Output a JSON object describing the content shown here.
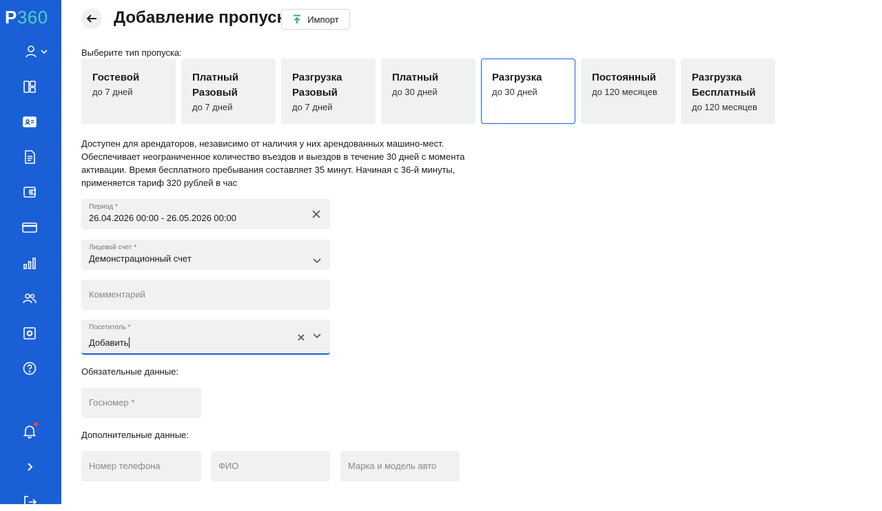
{
  "logo": {
    "p": "P",
    "num": "360"
  },
  "header": {
    "title": "Добавление пропуска",
    "import_label": "Импорт"
  },
  "pass_type": {
    "label": "Выберите тип пропуска:",
    "selected_index": 4,
    "options": [
      {
        "title": "Гостевой",
        "subtitle": "до 7 дней"
      },
      {
        "title": "Платный\nРазовый",
        "subtitle": "до 7 дней"
      },
      {
        "title": "Разгрузка\nРазовый",
        "subtitle": "до 7 дней"
      },
      {
        "title": "Платный",
        "subtitle": "до 30 дней"
      },
      {
        "title": "Разгрузка",
        "subtitle": "до 30 дней"
      },
      {
        "title": "Постоянный",
        "subtitle": "до 120 месяцев"
      },
      {
        "title": "Разгрузка\nБесплатный",
        "subtitle": "до 120 месяцев"
      }
    ]
  },
  "description": "Доступен для арендаторов, независимо от наличия у них арендованных машино-мест. Обеспечивает неограниченное количество въездов и выездов в течение 30 дней с момента активации. Время бесплатного пребывания составляет 35 минут. Начиная с 36-й минуты, применяется тариф 320 рублей в час",
  "form": {
    "period": {
      "label": "Период *",
      "value": "26.04.2026 00:00 - 26.05.2026 00:00"
    },
    "account": {
      "label": "Лицевой счет *",
      "value": "Демонстрационный счет"
    },
    "comment": {
      "placeholder": "Комментарий"
    },
    "visitor": {
      "label": "Посетитель *",
      "value": "Добавить"
    },
    "required_label": "Обязательные данные:",
    "plate": {
      "placeholder": "Госномер *"
    },
    "additional_label": "Дополнительные данные:",
    "phone": {
      "placeholder": "Номер телефона"
    },
    "fio": {
      "placeholder": "ФИО"
    },
    "car": {
      "placeholder": "Марка и модель авто"
    }
  },
  "colors": {
    "sidebar": "#1a5fd6",
    "accent": "#1a5fd6",
    "import_icon": "#2bb673",
    "notification_dot": "#f0443a"
  },
  "sidebar_icons": [
    "user-menu-icon",
    "dashboard-icon",
    "pass-card-icon",
    "document-icon",
    "wallet-icon",
    "payment-card-icon",
    "analytics-icon",
    "users-icon",
    "settings-icon",
    "help-icon",
    "notifications-icon",
    "expand-icon",
    "logout-icon"
  ]
}
